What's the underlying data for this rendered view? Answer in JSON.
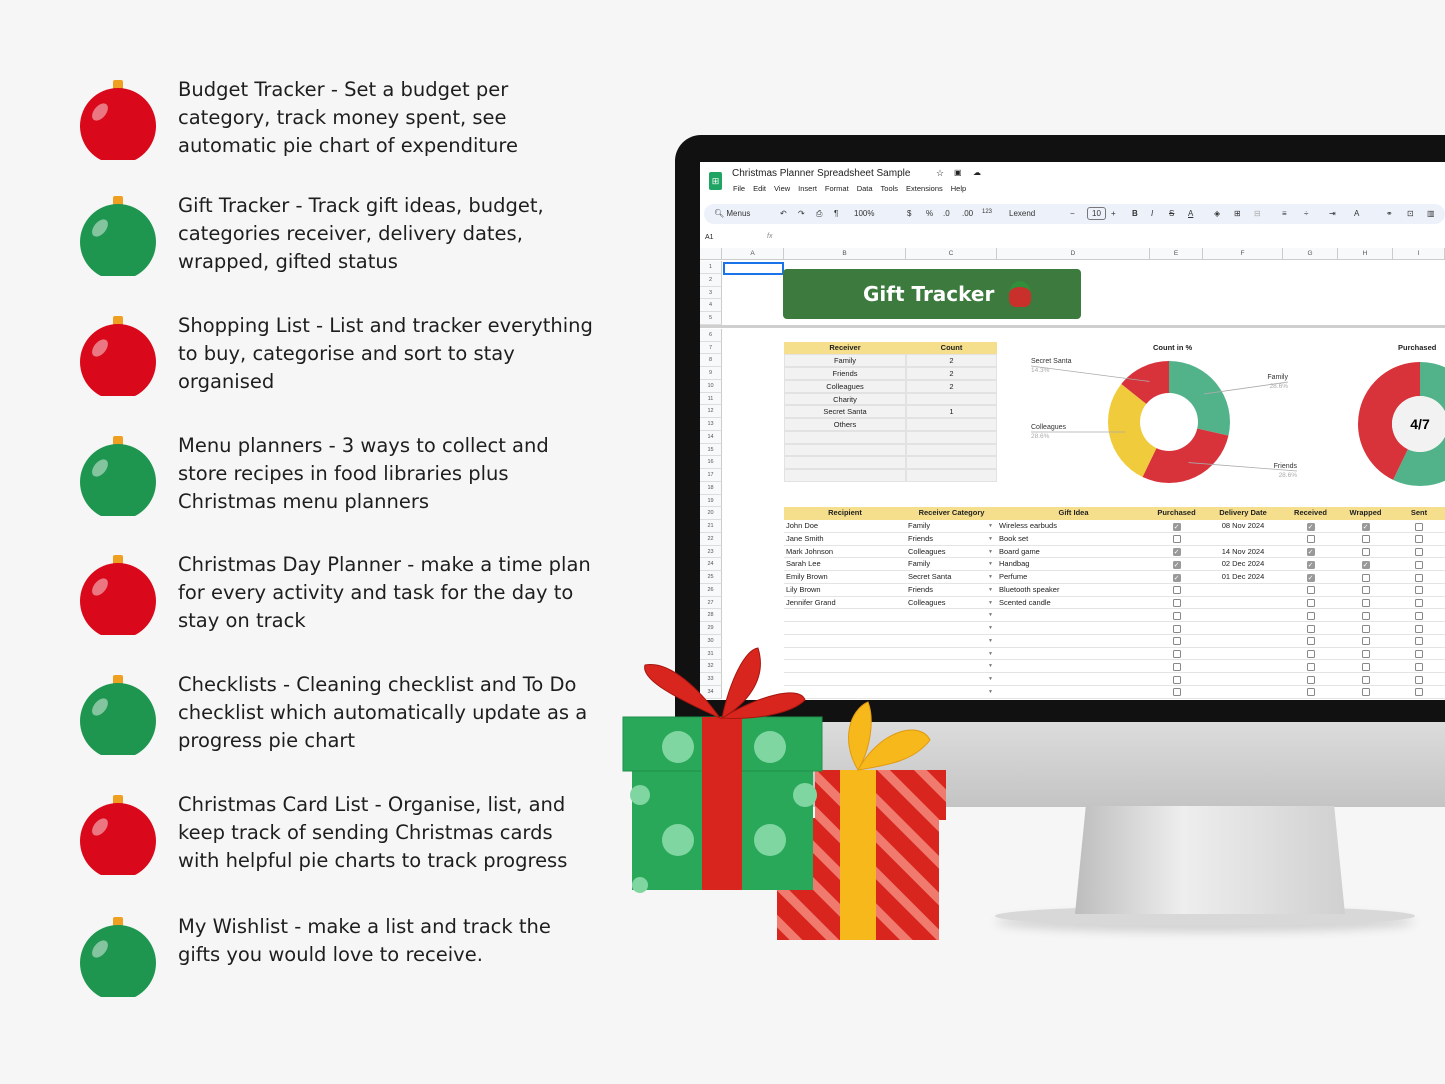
{
  "features": [
    {
      "text": "Budget Tracker - Set a budget per category, track money spent, see automatic pie chart of expenditure",
      "color": "red"
    },
    {
      "text": "Gift Tracker - Track gift ideas, budget, categories receiver, delivery dates, wrapped, gifted status",
      "color": "green"
    },
    {
      "text": "Shopping List - List and tracker everything to buy, categorise and sort to stay organised",
      "color": "red"
    },
    {
      "text": "Menu planners - 3 ways to collect and store recipes in food libraries plus Christmas menu planners",
      "color": "green"
    },
    {
      "text": "Christmas Day Planner - make a time plan for every activity and task for the day to stay on track",
      "color": "red"
    },
    {
      "text": "Checklists - Cleaning checklist and To Do checklist which automatically update as a progress pie chart",
      "color": "green"
    },
    {
      "text": "Christmas Card List - Organise, list, and keep track of sending Christmas cards with helpful pie charts to track progress",
      "color": "red"
    },
    {
      "text": "My Wishlist - make a list and track the gifts you would love to receive.",
      "color": "green"
    }
  ],
  "colors": {
    "red": "#d9091b",
    "green": "#1f9650",
    "cap": "#f0a020",
    "header": "#f6df8c",
    "banner": "#3d7a3d"
  },
  "sheet": {
    "title": "Christmas Planner Spreadsheet Sample",
    "menus": [
      "File",
      "Edit",
      "View",
      "Insert",
      "Format",
      "Data",
      "Tools",
      "Extensions",
      "Help"
    ],
    "toolbar": {
      "search": "Menus",
      "zoom": "100%",
      "currency": "$",
      "percent": "%",
      "dec_less": ".0",
      "dec_more": ".00",
      "number_format": "123",
      "font": "Lexend",
      "font_size": "10",
      "bold": "B",
      "italic": "I"
    },
    "cell_ref": "A1",
    "fx": "fx",
    "columns": [
      "A",
      "B",
      "C",
      "D",
      "E",
      "F",
      "G",
      "H",
      "I"
    ],
    "banner": "Gift Tracker",
    "summary": {
      "headers": [
        "Receiver",
        "Count"
      ],
      "rows": [
        [
          "Family",
          "2"
        ],
        [
          "Friends",
          "2"
        ],
        [
          "Colleagues",
          "2"
        ],
        [
          "Charity",
          ""
        ],
        [
          "Secret Santa",
          "1"
        ],
        [
          "Others",
          ""
        ],
        [
          "",
          ""
        ],
        [
          "",
          ""
        ],
        [
          "",
          ""
        ],
        [
          "",
          ""
        ]
      ]
    },
    "chart_count": {
      "type": "pie",
      "title": "Count in %",
      "slices": [
        {
          "label": "Family",
          "value": 28.6,
          "display": "28.6%",
          "color": "#52b38a"
        },
        {
          "label": "Friends",
          "value": 28.6,
          "display": "28.6%",
          "color": "#d8323a"
        },
        {
          "label": "Colleagues",
          "value": 28.6,
          "display": "28.6%",
          "color": "#f0cb3c"
        },
        {
          "label": "Secret Santa",
          "value": 14.3,
          "display": "14.3%",
          "color": "#d8323a"
        }
      ]
    },
    "chart_purchased": {
      "type": "pie",
      "title": "Purchased",
      "center_label": "4/7",
      "purchased": 4,
      "total": 7,
      "colors": [
        "#52b38a",
        "#d8323a"
      ]
    },
    "gifts": {
      "headers": [
        "Recipient",
        "Receiver Category",
        "Gift Idea",
        "Purchased",
        "Delivery Date",
        "Received",
        "Wrapped",
        "Sent"
      ],
      "rows": [
        {
          "recipient": "John Doe",
          "category": "Family",
          "idea": "Wireless earbuds",
          "purchased": true,
          "date": "08 Nov 2024",
          "received": true,
          "wrapped": true,
          "sent": false
        },
        {
          "recipient": "Jane Smith",
          "category": "Friends",
          "idea": "Book set",
          "purchased": false,
          "date": "",
          "received": false,
          "wrapped": false,
          "sent": false
        },
        {
          "recipient": "Mark Johnson",
          "category": "Colleagues",
          "idea": "Board game",
          "purchased": true,
          "date": "14 Nov 2024",
          "received": true,
          "wrapped": false,
          "sent": false
        },
        {
          "recipient": "Sarah Lee",
          "category": "Family",
          "idea": "Handbag",
          "purchased": true,
          "date": "02 Dec 2024",
          "received": true,
          "wrapped": true,
          "sent": false
        },
        {
          "recipient": "Emily Brown",
          "category": "Secret Santa",
          "idea": "Perfume",
          "purchased": true,
          "date": "01 Dec 2024",
          "received": true,
          "wrapped": false,
          "sent": false
        },
        {
          "recipient": "Lily Brown",
          "category": "Friends",
          "idea": "Bluetooth speaker",
          "purchased": false,
          "date": "",
          "received": false,
          "wrapped": false,
          "sent": false
        },
        {
          "recipient": "Jennifer Grand",
          "category": "Colleagues",
          "idea": "Scented candle",
          "purchased": false,
          "date": "",
          "received": false,
          "wrapped": false,
          "sent": false
        },
        {
          "recipient": "",
          "category": "",
          "idea": "",
          "purchased": false,
          "date": "",
          "received": false,
          "wrapped": false,
          "sent": false
        },
        {
          "recipient": "",
          "category": "",
          "idea": "",
          "purchased": false,
          "date": "",
          "received": false,
          "wrapped": false,
          "sent": false
        },
        {
          "recipient": "",
          "category": "",
          "idea": "",
          "purchased": false,
          "date": "",
          "received": false,
          "wrapped": false,
          "sent": false
        },
        {
          "recipient": "",
          "category": "",
          "idea": "",
          "purchased": false,
          "date": "",
          "received": false,
          "wrapped": false,
          "sent": false
        },
        {
          "recipient": "",
          "category": "",
          "idea": "",
          "purchased": false,
          "date": "",
          "received": false,
          "wrapped": false,
          "sent": false
        },
        {
          "recipient": "",
          "category": "",
          "idea": "",
          "purchased": false,
          "date": "",
          "received": false,
          "wrapped": false,
          "sent": false
        },
        {
          "recipient": "",
          "category": "",
          "idea": "",
          "purchased": false,
          "date": "",
          "received": false,
          "wrapped": false,
          "sent": false
        }
      ]
    }
  }
}
